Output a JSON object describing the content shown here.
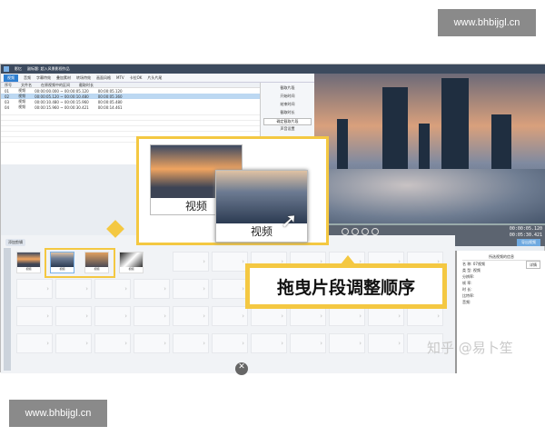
{
  "watermark_top": "www.bhbijgl.cn",
  "watermark_bottom": "www.bhbijgl.cn",
  "watermark_zhihu": "知乎 @易卜笙",
  "app": {
    "title": "影忆",
    "subtitle": "副标题: 超入风景影视作品"
  },
  "menu": [
    "视频",
    "音频",
    "字幕特效",
    "叠加素材",
    "转场特效",
    "画面风格",
    "MTV",
    "卡拉OK",
    "片头片尾"
  ],
  "table": {
    "headers": [
      "序号",
      "文件名",
      "在原视频中的区间",
      "截取时长"
    ],
    "rows": [
      [
        "01",
        "视频",
        "00:00:00.000 ~ 00:00:05.120",
        "00:00:05.120"
      ],
      [
        "02",
        "视频",
        "00:00:05.120 ~ 00:00:10.480",
        "00:00:05.360"
      ],
      [
        "03",
        "视频",
        "00:00:10.480 ~ 00:00:15.960",
        "00:00:05.480"
      ],
      [
        "04",
        "视频",
        "00:00:15.960 ~ 00:00:30.421",
        "00:00:14.461"
      ]
    ]
  },
  "settings": {
    "title": "截取片段",
    "start": "开始时间",
    "end": "结束时间",
    "length": "截取时长",
    "confirm": "确定截取片段",
    "sound": "声音设置"
  },
  "player": {
    "current": "00:00:05.120",
    "total": "00:05:30.421",
    "export": "导出视频"
  },
  "timeline": {
    "label": "添加剪辑",
    "clips": [
      "视频",
      "视频",
      "视频",
      "视频"
    ]
  },
  "popup": {
    "card1": "视频",
    "card2": "视频"
  },
  "callout": "拖曳片段调整顺序",
  "props": {
    "title": "所选视频的信息",
    "rows": [
      "名 称: 07视频",
      "类 型: 视频",
      "分辨率:",
      "帧 率:",
      "时 长:",
      "比特率:",
      "音频:"
    ],
    "button": "详情"
  },
  "colors": {
    "accent": "#f4c842",
    "selected": "#bcd8f2",
    "title": "#3c4a5e"
  }
}
